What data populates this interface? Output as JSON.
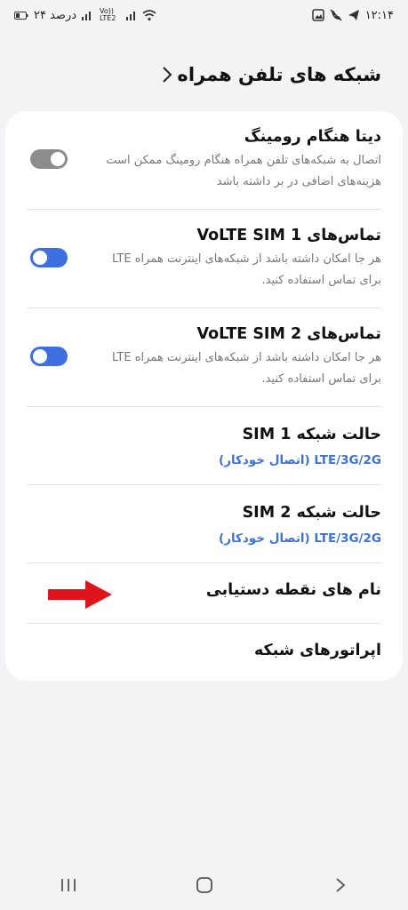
{
  "status_bar": {
    "time": "۱۲:۱۴",
    "battery": "۲۴ درصد",
    "volte_label": "Vo))\nLTE2"
  },
  "header": {
    "title": "شبکه های تلفن همراه"
  },
  "settings": {
    "data_roaming": {
      "title": "دیتا هنگام رومینگ",
      "description": "اتصال به شبکه‌های تلفن همراه هنگام رومینگ ممکن است هزینه‌های اضافی در بر داشته باشد",
      "enabled": false
    },
    "volte_sim1": {
      "title": "تماس‌های VoLTE SIM 1",
      "description": "هر جا امکان داشته باشد از شبکه‌های اینترنت همراه LTE برای تماس استفاده کنید.",
      "enabled": true
    },
    "volte_sim2": {
      "title": "تماس‌های VoLTE SIM 2",
      "description": "هر جا امکان داشته باشد از شبکه‌های اینترنت همراه LTE برای تماس استفاده کنید.",
      "enabled": true
    },
    "network_mode_sim1": {
      "title": "حالت شبکه SIM 1",
      "value": "LTE/3G/2G (اتصال خودکار)"
    },
    "network_mode_sim2": {
      "title": "حالت شبکه SIM 2",
      "value": "LTE/3G/2G (اتصال خودکار)"
    },
    "access_point_names": {
      "title": "نام های نقطه دستیابی"
    },
    "network_operators": {
      "title": "اپراتورهای شبکه"
    }
  },
  "colors": {
    "accent": "#3e6fe0",
    "value_text": "#3b73d6",
    "arrow": "#e0151b",
    "toggle_off": "#8c8c8c"
  }
}
